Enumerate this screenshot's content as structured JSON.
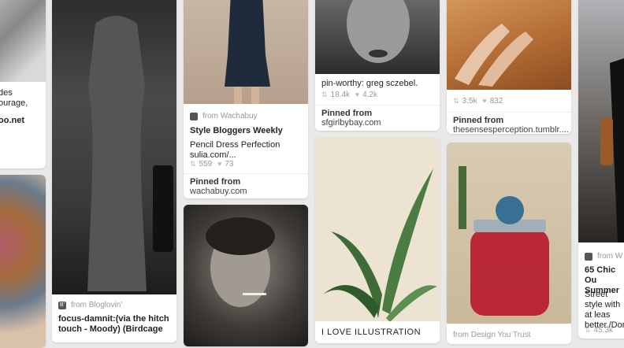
{
  "col0": {
    "top": {
      "desc": "des\nourage,",
      "domain": "oo.net"
    }
  },
  "col1": {
    "source": "from Bloglovin'",
    "source_icon": "B'",
    "desc": "focus-damnit:(via the hitch touch - Moody) (Birdcage"
  },
  "col2": {
    "top": {
      "source": "from Wachabuy",
      "board": "Style Bloggers Weekly",
      "desc": "Pencil Dress Perfection sulia.com/...",
      "repins": "559",
      "likes": "73",
      "pinned_label": "Pinned from",
      "pinned_domain": "wachabuy.com"
    }
  },
  "col3": {
    "top": {
      "desc": "pin-worthy: greg sczebel.",
      "repins": "18.4k",
      "likes": "4.2k",
      "pinned_label": "Pinned from",
      "pinned_domain": "sfgirlbybay.com"
    },
    "bottom": {
      "desc": "I LOVE ILLUSTRATION"
    }
  },
  "col4": {
    "top": {
      "repins": "3.5k",
      "likes": "832",
      "pinned_label": "Pinned from",
      "pinned_domain": "thesensesperception.tumblr...."
    },
    "bottom": {
      "desc": "from Design You Trust"
    }
  },
  "col5": {
    "source": "from W",
    "board": "65 Chic Ou Summer",
    "desc": "Street style with at leas better./Dor",
    "repins": "45.3k"
  }
}
